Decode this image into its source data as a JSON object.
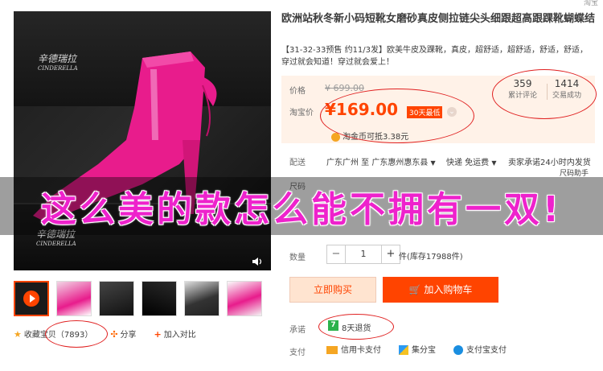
{
  "corner_text": "淘宝",
  "product": {
    "title": "欧洲站秋冬新小码短靴女磨砂真皮侧拉链尖头细跟超高跟踝靴蝴蝶结",
    "subtitle": "【31-32-33预售 约11/3发】欧美牛皮及踝靴，真皮，超舒适，超舒适，舒适，舒适，穿过就会知道！穿过就会爱上！",
    "brand_text": "辛德瑞拉",
    "brand_en": "CINDERELLA"
  },
  "price": {
    "price_label": "价格",
    "original_price": "¥ 699.00",
    "taobao_label": "淘宝价",
    "current_price": "¥169.00",
    "badge": "30天最低",
    "coin_text": "淘金币可抵3.38元",
    "review_count": "359",
    "review_label": "累计评论",
    "sold_count": "1414",
    "sold_label": "交易成功"
  },
  "shipping": {
    "label": "配送",
    "text": "广东广州 至  广东惠州惠东县",
    "express": "快递 免运费",
    "promise": "卖家承诺24小时内发货",
    "size_label": "尺码助手"
  },
  "size_row_label": "尺码",
  "quantity": {
    "label": "数量",
    "minus": "−",
    "value": "1",
    "plus": "+",
    "stock": "件(库存17988件)"
  },
  "buttons": {
    "buy_now": "立即购买",
    "add_cart": "加入购物车"
  },
  "promise": {
    "label": "承诺",
    "badge": "7",
    "text": "8天退货"
  },
  "payment": {
    "label": "支付",
    "options": [
      "信用卡支付",
      "集分宝",
      "支付宝支付"
    ]
  },
  "left_actions": {
    "favorite": "收藏宝贝（7893）",
    "share": "分享",
    "compare": "加入对比"
  },
  "overlay_caption": "这么美的款怎么能不拥有一双!",
  "colors": {
    "accent": "#ff4400",
    "boot": "#e81c8c",
    "caption": "#ee22cc",
    "annotation": "#e02020"
  }
}
